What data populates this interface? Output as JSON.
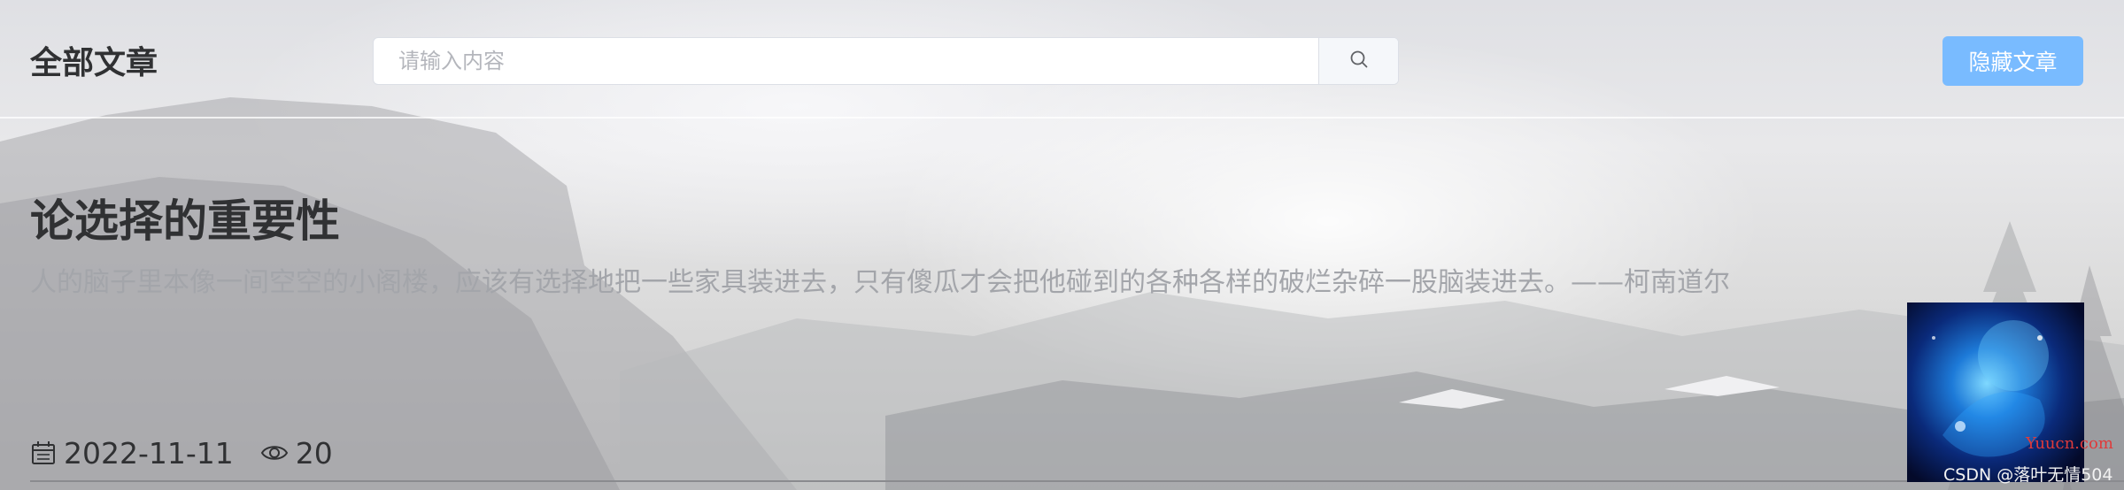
{
  "header": {
    "title": "全部文章",
    "search": {
      "placeholder": "请输入内容",
      "value": "",
      "icon": "search-icon"
    },
    "hide_button_label": "隐藏文章"
  },
  "article": {
    "title": "论选择的重要性",
    "summary": "人的脑子里本像一间空空的小阁楼，应该有选择地把一些家具装进去，只有傻瓜才会把他碰到的各种各样的破烂杂碎一股脑装进去。——柯南道尔",
    "date": "2022-11-11",
    "views": "20",
    "date_icon": "calendar-icon",
    "views_icon": "eye-icon"
  },
  "watermark": {
    "site": "Yuucn.com",
    "csdn": "CSDN @落叶无情504"
  },
  "colors": {
    "accent_button": "#79bbff",
    "title_text": "#303133",
    "summary_text": "#a3a5aa"
  }
}
